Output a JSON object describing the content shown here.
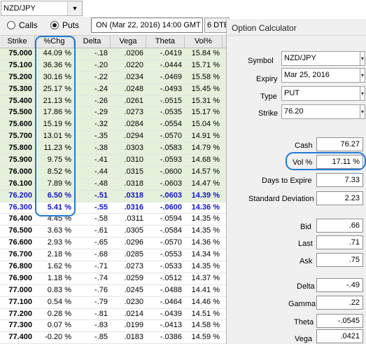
{
  "symbol_box": {
    "value": "NZD/JPY",
    "arrow": "▼"
  },
  "type_toggle": {
    "calls_label": "Calls",
    "puts_label": "Puts",
    "selected": "puts"
  },
  "date": {
    "label": "ON (Mar 22, 2016) 14:00 GMT"
  },
  "dte": {
    "label": "6 DTE"
  },
  "chain": {
    "headers": [
      "Strike",
      "%Chg",
      "Delta",
      "Vega",
      "Theta",
      "Vol%"
    ],
    "rows": [
      [
        "75.000",
        "44.09 %",
        "-.18",
        ".0206",
        "-.0419",
        "15.84 %"
      ],
      [
        "75.100",
        "36.36 %",
        "-.20",
        ".0220",
        "-.0444",
        "15.71 %"
      ],
      [
        "75.200",
        "30.16 %",
        "-.22",
        ".0234",
        "-.0469",
        "15.58 %"
      ],
      [
        "75.300",
        "25.17 %",
        "-.24",
        ".0248",
        "-.0493",
        "15.45 %"
      ],
      [
        "75.400",
        "21.13 %",
        "-.26",
        ".0261",
        "-.0515",
        "15.31 %"
      ],
      [
        "75.500",
        "17.86 %",
        "-.29",
        ".0273",
        "-.0535",
        "15.17 %"
      ],
      [
        "75.600",
        "15.19 %",
        "-.32",
        ".0284",
        "-.0554",
        "15.04 %"
      ],
      [
        "75.700",
        "13.01 %",
        "-.35",
        ".0294",
        "-.0570",
        "14.91 %"
      ],
      [
        "75.800",
        "11.23 %",
        "-.38",
        ".0303",
        "-.0583",
        "14.79 %"
      ],
      [
        "75.900",
        "9.75 %",
        "-.41",
        ".0310",
        "-.0593",
        "14.68 %"
      ],
      [
        "76.000",
        "8.52 %",
        "-.44",
        ".0315",
        "-.0600",
        "14.57 %"
      ],
      [
        "76.100",
        "7.89 %",
        "-.48",
        ".0318",
        "-.0603",
        "14.47 %"
      ],
      [
        "76.200",
        "6.50 %",
        "-.51",
        ".0318",
        "-.0603",
        "14.39 %"
      ],
      [
        "76.300",
        "5.41 %",
        "-.55",
        ".0316",
        "-.0600",
        "14.36 %"
      ],
      [
        "76.400",
        "4.45 %",
        "-.58",
        ".0311",
        "-.0594",
        "14.35 %"
      ],
      [
        "76.500",
        "3.63 %",
        "-.61",
        ".0305",
        "-.0584",
        "14.35 %"
      ],
      [
        "76.600",
        "2.93 %",
        "-.65",
        ".0296",
        "-.0570",
        "14.36 %"
      ],
      [
        "76.700",
        "2.18 %",
        "-.68",
        ".0285",
        "-.0553",
        "14.34 %"
      ],
      [
        "76.800",
        "1.62 %",
        "-.71",
        ".0273",
        "-.0533",
        "14.35 %"
      ],
      [
        "76.900",
        "1.18 %",
        "-.74",
        ".0259",
        "-.0512",
        "14.37 %"
      ],
      [
        "77.000",
        "0.83 %",
        "-.76",
        ".0245",
        "-.0488",
        "14.41 %"
      ],
      [
        "77.100",
        "0.54 %",
        "-.79",
        ".0230",
        "-.0464",
        "14.46 %"
      ],
      [
        "77.200",
        "0.28 %",
        "-.81",
        ".0214",
        "-.0439",
        "14.51 %"
      ],
      [
        "77.300",
        "0.07 %",
        "-.83",
        ".0199",
        "-.0413",
        "14.58 %"
      ],
      [
        "77.400",
        "-0.20 %",
        "-.85",
        ".0183",
        "-.0386",
        "14.59 %"
      ]
    ],
    "highlighted_rows": [
      "76.200",
      "76.300"
    ]
  },
  "calculator": {
    "title": "Option Calculator",
    "symbol_label": "Symbol",
    "symbol_value": "NZD/JPY",
    "expiry_label": "Expiry",
    "expiry_value": "Mar 25, 2016",
    "type_label": "Type",
    "type_value": "PUT",
    "strike_label": "Strike",
    "strike_value": "76.20",
    "cash_label": "Cash",
    "cash_value": "76.27",
    "vol_label": "Vol %",
    "vol_value": "17.11 %",
    "days_label": "Days to Expire",
    "days_value": "7.33",
    "stddev_label": "Standard Deviation",
    "stddev_value": "2.23",
    "bid_label": "Bid",
    "bid_value": ".66",
    "last_label": "Last",
    "last_value": ".71",
    "ask_label": "Ask",
    "ask_value": ".75",
    "delta_label": "Delta",
    "delta_value": "-.49",
    "gamma_label": "Gamma",
    "gamma_value": ".22",
    "theta_label": "Theta",
    "theta_value": "-.0545",
    "vega_label": "Vega",
    "vega_value": ".0421"
  },
  "colors": {
    "itm_row": "#e6f1db",
    "selected_text": "#1414c8",
    "annotation": "#1e7ad6"
  }
}
